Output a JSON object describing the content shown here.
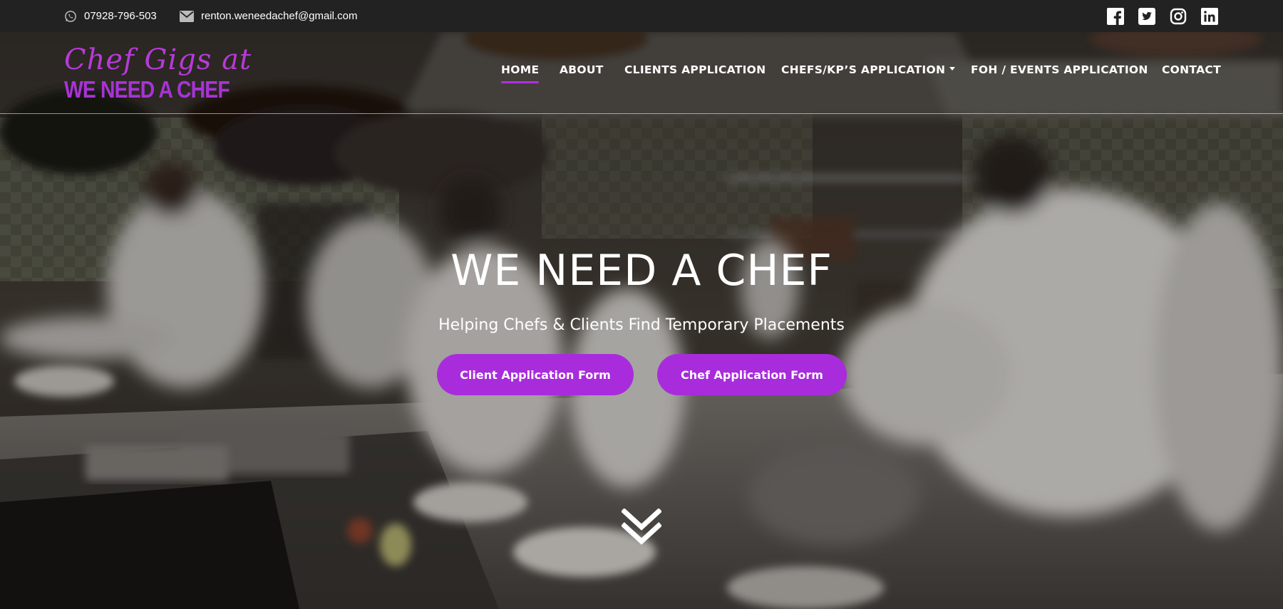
{
  "topbar": {
    "phone_icon": "whatsapp-icon",
    "phone": "07928-796-503",
    "email_icon": "envelope-icon",
    "email": "renton.weneedachef@gmail.com",
    "social": [
      {
        "name": "facebook-icon"
      },
      {
        "name": "twitter-icon"
      },
      {
        "name": "instagram-icon"
      },
      {
        "name": "linkedin-icon"
      }
    ]
  },
  "logo": {
    "script_text": "Chef Gigs at",
    "block_text": "WE NEED A CHEF"
  },
  "nav": {
    "items": [
      {
        "label": "HOME",
        "active": true
      },
      {
        "label": "ABOUT"
      },
      {
        "label": "CLIENTS APPLICATION"
      },
      {
        "label": "CHEFS/KP’S APPLICATION",
        "has_dropdown": true
      },
      {
        "label": "FOH / EVENTS APPLICATION"
      },
      {
        "label": "CONTACT"
      }
    ]
  },
  "hero": {
    "title": "WE NEED A CHEF",
    "subtitle": "Helping Chefs & Clients Find Temporary Placements",
    "buttons": [
      {
        "label": "Client Application Form"
      },
      {
        "label": "Chef Application Form"
      }
    ],
    "scroll_icon": "double-chevron-down-icon"
  },
  "colors": {
    "topbar_bg": "#222222",
    "accent": "#a82cdc",
    "logo": "#b73ad9",
    "text": "#ffffff"
  }
}
